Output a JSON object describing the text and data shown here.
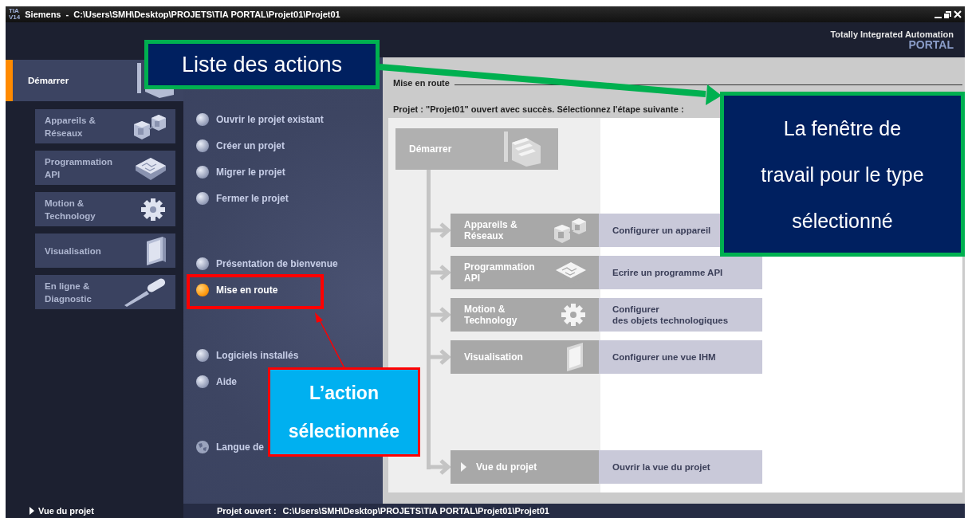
{
  "window": {
    "logo": [
      "TIA",
      "V14"
    ],
    "title": "Siemens  -  C:\\Users\\SMH\\Desktop\\PROJETS\\TIA PORTAL\\Projet01\\Projet01"
  },
  "header": {
    "line1": "Totally Integrated Automation",
    "line2": "PORTAL"
  },
  "sidebar": {
    "items": [
      {
        "label": "Démarrer",
        "kind": "start",
        "selected": true
      },
      {
        "label": "Appareils &\nRéseaux",
        "kind": "devices",
        "selected": false
      },
      {
        "label": "Programmation\nAPI",
        "kind": "plc",
        "selected": false
      },
      {
        "label": "Motion &\nTechnology",
        "kind": "motion",
        "selected": false
      },
      {
        "label": "Visualisation",
        "kind": "hmi",
        "selected": false
      },
      {
        "label": "En ligne &\nDiagnostic",
        "kind": "online",
        "selected": false
      }
    ],
    "footer_link": "Vue du projet"
  },
  "action_groups": [
    [
      {
        "label": "Ouvrir le projet existant",
        "kind": "bullet",
        "selected": false
      },
      {
        "label": "Créer un projet",
        "kind": "bullet",
        "selected": false
      },
      {
        "label": "Migrer le projet",
        "kind": "bullet",
        "selected": false
      },
      {
        "label": "Fermer le projet",
        "kind": "bullet",
        "selected": false
      }
    ],
    [
      {
        "label": "Présentation de bienvenue",
        "kind": "bullet",
        "selected": false
      },
      {
        "label": "Mise en route",
        "kind": "bullet",
        "selected": true
      }
    ],
    [
      {
        "label": "Logiciels installés",
        "kind": "bullet",
        "selected": false
      },
      {
        "label": "Aide",
        "kind": "bullet",
        "selected": false
      }
    ],
    [
      {
        "label": "Langue de",
        "kind": "globe",
        "selected": false
      }
    ]
  ],
  "work": {
    "heading": "Mise en route",
    "message": "Projet : \"Projet01\" ouvert avec succès. Sélectionnez l'étape suivante :",
    "start": {
      "label": "Démarrer"
    },
    "steps": [
      {
        "label": "Appareils &\nRéseaux",
        "kind": "devices",
        "description": "Configurer un appareil"
      },
      {
        "label": "Programmation\nAPI",
        "kind": "plc",
        "description": "Ecrire un programme API"
      },
      {
        "label": "Motion &\nTechnology",
        "kind": "motion",
        "description": "Configurer\ndes objets technologiques"
      },
      {
        "label": "Visualisation",
        "kind": "hmi",
        "description": "Configurer une vue IHM"
      },
      {
        "label": "Vue du projet",
        "kind": "project-view",
        "description": "Ouvrir la vue du projet"
      }
    ]
  },
  "status_bar": {
    "label": "Projet ouvert :",
    "path": "C:\\Users\\SMH\\Desktop\\PROJETS\\TIA PORTAL\\Projet01\\Projet01"
  },
  "annotations": [
    {
      "kind": "list",
      "text": "Liste des actions"
    },
    {
      "kind": "window",
      "text": "La fenêtre de\ntravail pour le type\nsélectionné"
    },
    {
      "kind": "action",
      "text": "L’action\nsélectionnée"
    }
  ]
}
